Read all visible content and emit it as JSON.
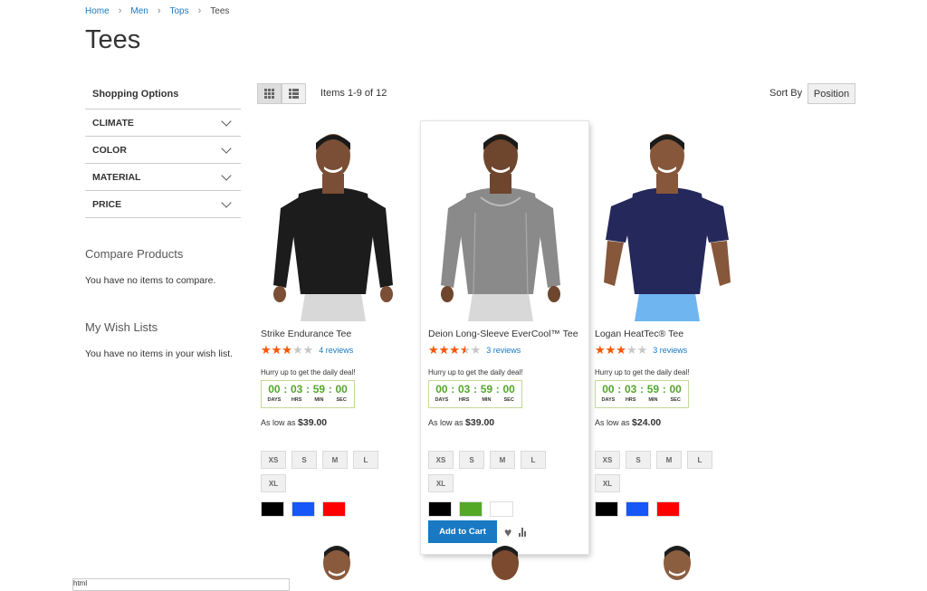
{
  "breadcrumbs": [
    {
      "label": "Home"
    },
    {
      "label": "Men"
    },
    {
      "label": "Tops"
    },
    {
      "label": "Tees"
    }
  ],
  "page_title": "Tees",
  "sidebar": {
    "shopping_options": "Shopping Options",
    "filters": [
      {
        "label": "CLIMATE"
      },
      {
        "label": "COLOR"
      },
      {
        "label": "MATERIAL"
      },
      {
        "label": "PRICE"
      }
    ],
    "compare_title": "Compare Products",
    "compare_text": "You have no items to compare.",
    "wishlist_title": "My Wish Lists",
    "wishlist_text": "You have no items in your wish list."
  },
  "toolbar": {
    "items_count": "Items 1-9 of 12",
    "sort_label": "Sort By",
    "sort_value": "Position",
    "grid_mode_icon": "grid-icon",
    "list_mode_icon": "list-icon"
  },
  "deal": {
    "hurry_text": "Hurry up to get the daily deal!",
    "days": "00",
    "hrs": "03",
    "min": "59",
    "sec": "00",
    "days_label": "DAYS",
    "hrs_label": "HRS",
    "min_label": "MIN",
    "sec_label": "SEC",
    "colon": ":"
  },
  "products": [
    {
      "name": "Strike Endurance Tee",
      "rating_percent": 60,
      "reviews": "4 reviews",
      "price_prefix": "As low as",
      "price": "$39.00",
      "sizes": [
        "XS",
        "S",
        "M",
        "L",
        "XL"
      ],
      "swatches": [
        "#000000",
        "#1857f7",
        "#ff0000"
      ],
      "shirt_color": "#1c1c1c"
    },
    {
      "name": "Deion Long-Sleeve EverCool™ Tee",
      "rating_percent": 70,
      "reviews": "3 reviews",
      "price_prefix": "As low as",
      "price": "$39.00",
      "sizes": [
        "XS",
        "S",
        "M",
        "L",
        "XL"
      ],
      "swatches": [
        "#000000",
        "#53a828",
        "#ffffff"
      ],
      "shirt_color": "#8a8a8a",
      "add_to_cart": "Add to Cart"
    },
    {
      "name": "Logan HeatTec® Tee",
      "rating_percent": 60,
      "reviews": "3 reviews",
      "price_prefix": "As low as",
      "price": "$24.00",
      "sizes": [
        "XS",
        "S",
        "M",
        "L",
        "XL"
      ],
      "swatches": [
        "#000000",
        "#1857f7",
        "#ff0000"
      ],
      "shirt_color": "#24285a"
    }
  ],
  "status_bar_text": "html",
  "colors": {
    "link": "#1979c3",
    "star": "#ff5501",
    "timer_green": "#55a52d",
    "button_blue": "#1979c3"
  }
}
